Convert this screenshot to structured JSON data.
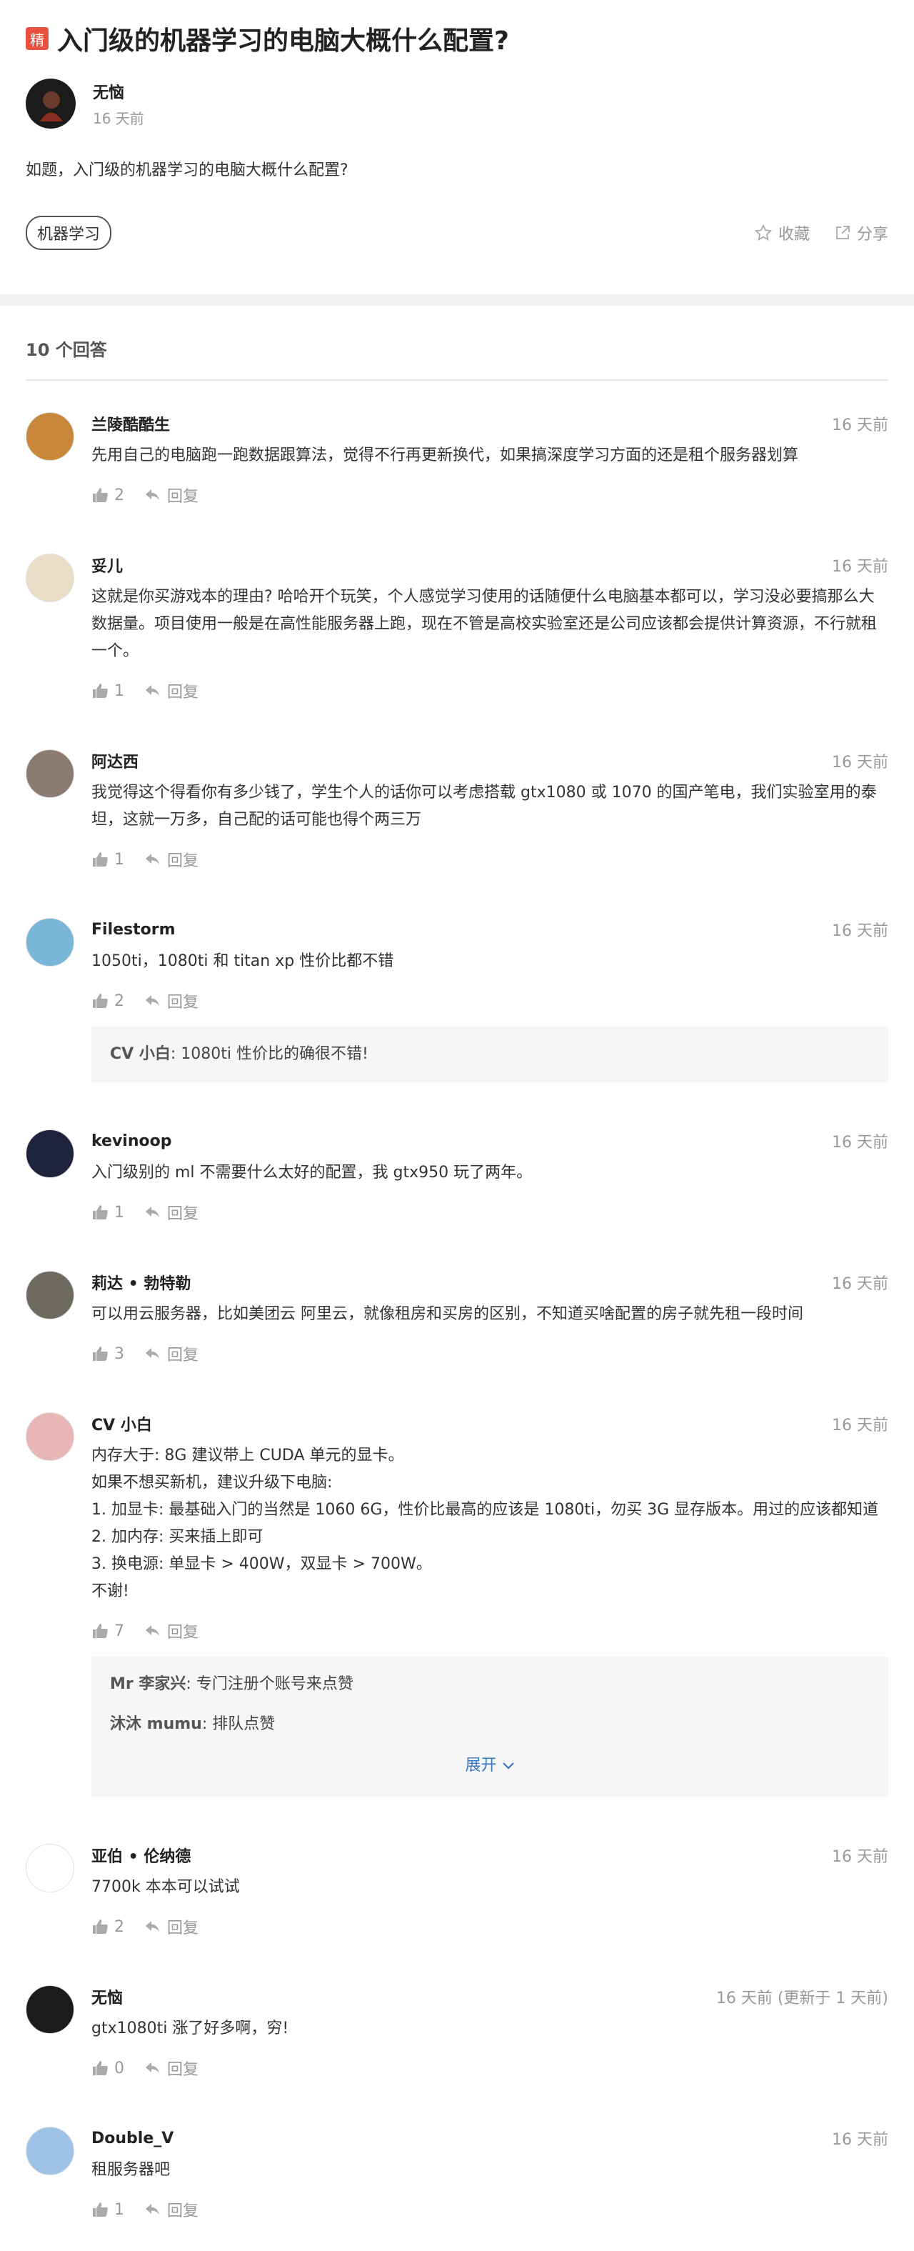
{
  "question": {
    "badge": "精",
    "title": "入门级的机器学习的电脑大概什么配置?",
    "author_name": "无恼",
    "author_time": "16 天前",
    "body": "如题，入门级的机器学习的电脑大概什么配置?",
    "tag": "机器学习",
    "favorite_label": "收藏",
    "share_label": "分享"
  },
  "answers_count_label": "10 个回答",
  "answers": [
    {
      "name": "兰陵酷酷生",
      "time": "16 天前",
      "content": "先用自己的电脑跑一跑数据跟算法，觉得不行再更新换代，如果搞深度学习方面的还是租个服务器划算",
      "likes": "2",
      "reply_label": "回复",
      "avatar_color": "#c8873a"
    },
    {
      "name": "妥儿",
      "time": "16 天前",
      "content": "这就是你买游戏本的理由? 哈哈开个玩笑，个人感觉学习使用的话随便什么电脑基本都可以，学习没必要搞那么大数据量。项目使用一般是在高性能服务器上跑，现在不管是高校实验室还是公司应该都会提供计算资源，不行就租一个。",
      "likes": "1",
      "reply_label": "回复",
      "avatar_color": "#e9ddc6"
    },
    {
      "name": "阿达西",
      "time": "16 天前",
      "content": "我觉得这个得看你有多少钱了，学生个人的话你可以考虑搭载 gtx1080 或 1070 的国产笔电，我们实验室用的泰坦，这就一万多，自己配的话可能也得个两三万",
      "likes": "1",
      "reply_label": "回复",
      "avatar_color": "#8a7a70"
    },
    {
      "name": "Filestorm",
      "time": "16 天前",
      "content": "1050ti，1080ti 和 titan xp 性价比都不错",
      "likes": "2",
      "reply_label": "回复",
      "avatar_color": "#7ab6d8",
      "replies": [
        {
          "name": "CV 小白",
          "text": "1080ti 性价比的确很不错!"
        }
      ]
    },
    {
      "name": "kevinoop",
      "time": "16 天前",
      "content": "入门级别的 ml 不需要什么太好的配置，我 gtx950 玩了两年。",
      "likes": "1",
      "reply_label": "回复",
      "avatar_color": "#20233d"
    },
    {
      "name": "莉达 • 勃特勒",
      "time": "16 天前",
      "content": "可以用云服务器，比如美团云 阿里云，就像租房和买房的区别，不知道买啥配置的房子就先租一段时间",
      "likes": "3",
      "reply_label": "回复",
      "avatar_color": "#6e6a60"
    },
    {
      "name": "CV 小白",
      "time": "16 天前",
      "content": "内存大于: 8G 建议带上 CUDA 单元的显卡。\n如果不想买新机，建议升级下电脑:\n1. 加显卡: 最基础入门的当然是 1060 6G，性价比最高的应该是 1080ti，勿买 3G 显存版本。用过的应该都知道\n2. 加内存: 买来插上即可\n3. 换电源: 单显卡 > 400W，双显卡 > 700W。\n不谢!",
      "likes": "7",
      "reply_label": "回复",
      "avatar_color": "#e8b7b5",
      "replies": [
        {
          "name": "Mr 李家兴",
          "text": "专门注册个账号来点赞"
        },
        {
          "name": "沐沐 mumu",
          "text": "排队点赞"
        }
      ],
      "expand_label": "展开"
    },
    {
      "name": "亚伯 • 伦纳德",
      "time": "16 天前",
      "content": "7700k 本本可以试试",
      "likes": "2",
      "reply_label": "回复",
      "avatar_color": "#ffffff"
    },
    {
      "name": "无恼",
      "time": "16 天前 (更新于 1 天前)",
      "content": "gtx1080ti 涨了好多啊，穷!",
      "likes": "0",
      "reply_label": "回复",
      "avatar_color": "#1b1b1b"
    },
    {
      "name": "Double_V",
      "time": "16 天前",
      "content": "租服务器吧",
      "likes": "1",
      "reply_label": "回复",
      "avatar_color": "#9fc3e6"
    }
  ]
}
